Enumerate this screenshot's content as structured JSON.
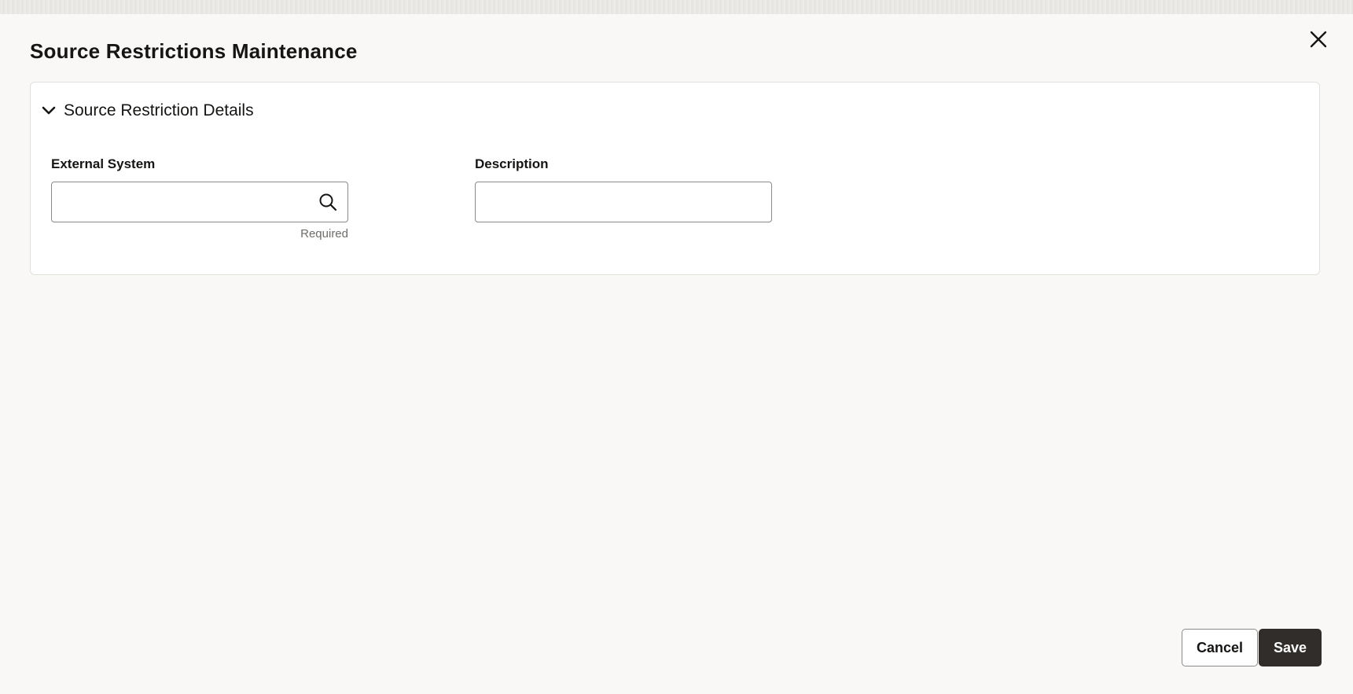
{
  "dialog": {
    "title": "Source Restrictions Maintenance",
    "close_icon": "close-icon"
  },
  "section": {
    "title": "Source Restriction Details",
    "expanded": true,
    "toggle_icon": "chevron-down-icon"
  },
  "fields": {
    "external_system": {
      "label": "External System",
      "value": "",
      "helper": "Required",
      "icon": "search-icon"
    },
    "description": {
      "label": "Description",
      "value": ""
    }
  },
  "footer": {
    "cancel_label": "Cancel",
    "save_label": "Save"
  },
  "colors": {
    "background": "#f9f8f6",
    "primary_button": "#312d2a",
    "text": "#161513",
    "helper_text": "#6f6c69"
  }
}
